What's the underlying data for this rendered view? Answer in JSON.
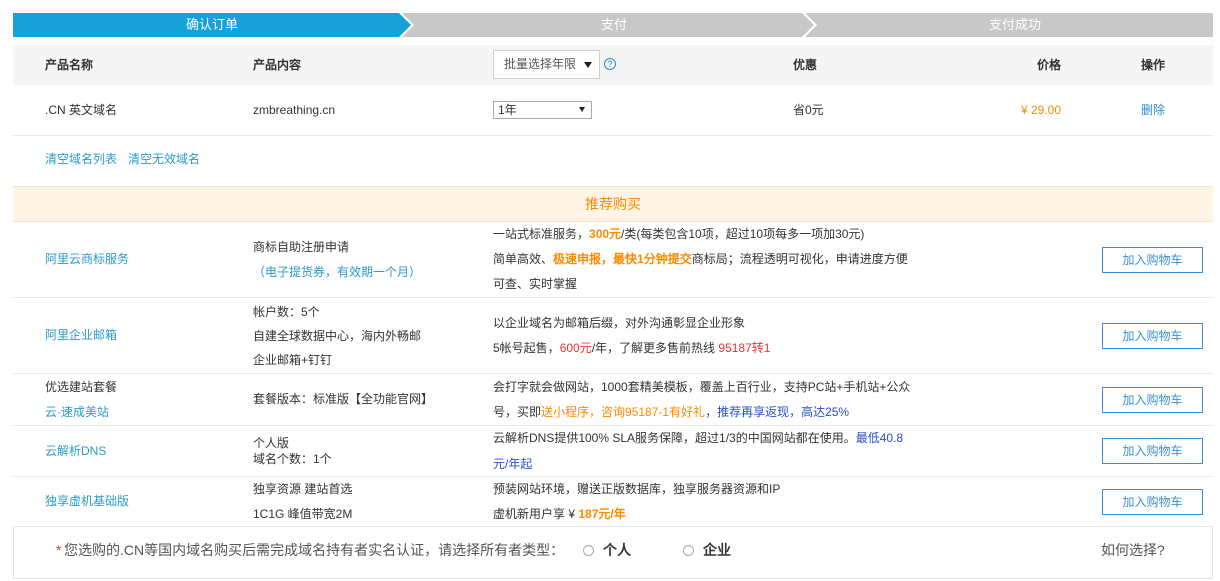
{
  "steps": [
    {
      "label": "确认订单",
      "active": true
    },
    {
      "label": "支付",
      "active": false
    },
    {
      "label": "支付成功",
      "active": false
    }
  ],
  "order": {
    "headers": {
      "name": "产品名称",
      "content": "产品内容",
      "period_select": "批量选择年限",
      "discount": "优惠",
      "price": "价格",
      "action": "操作"
    },
    "help_icon": "question-circle-icon",
    "help_glyph": "?",
    "select_icon": "caret-down-icon",
    "rows": [
      {
        "name": ".CN 英文域名",
        "content": "zmbreathing.cn",
        "period": "1年",
        "discount": "省0元",
        "price": "¥ 29.00",
        "action": "删除"
      }
    ]
  },
  "links": {
    "clear_list": "清空域名列表",
    "clear_invalid": "清空无效域名"
  },
  "recommend": {
    "title": "推荐购买",
    "rows": [
      {
        "name_lines": [
          {
            "text": "阿里云商标服务",
            "link": true
          }
        ],
        "content_lines": [
          {
            "text": "商标自助注册申请"
          },
          {
            "text": "（电子提货券，有效期一个月）",
            "color": "#2d9ac8"
          }
        ],
        "desc_lines": [
          [
            {
              "text": "一站式标准服务，"
            },
            {
              "text": "300元",
              "color": "#ff8a00",
              "bold": true
            },
            {
              "text": "/类(每类包含10项，超过10项每多一项加30元)"
            }
          ],
          [
            {
              "text": "简单高效、"
            },
            {
              "text": "极速申报，最快1分钟提交",
              "color": "#ff8a00",
              "bold": true
            },
            {
              "text": "商标局；流程透明可视化，申请进度方便"
            }
          ],
          [
            {
              "text": "可查、实时掌握"
            }
          ]
        ],
        "button": "加入购物车"
      },
      {
        "name_lines": [
          {
            "text": "阿里企业邮箱",
            "link": true
          }
        ],
        "content_lines": [
          {
            "text": "帐户数：5个"
          },
          {
            "text": "自建全球数据中心，海内外畅邮"
          },
          {
            "text": "企业邮箱+钉钉"
          }
        ],
        "desc_lines": [
          [
            {
              "text": "以企业域名为邮箱后缀，对外沟通彰显企业形象"
            }
          ],
          [
            {
              "text": "5帐号起售，"
            },
            {
              "text": "600元",
              "color": "#e8382f"
            },
            {
              "text": "/年，了解更多售前热线 "
            },
            {
              "text": "95187转1",
              "color": "#e8382f"
            }
          ]
        ],
        "button": "加入购物车"
      },
      {
        "name_lines": [
          {
            "text": "优选建站套餐",
            "link": false
          },
          {
            "text": "云·速成美站",
            "link": true
          }
        ],
        "content_lines": [
          {
            "text": "套餐版本：标准版【全功能官网】"
          }
        ],
        "desc_lines": [
          [
            {
              "text": "会打字就会做网站，1000套精美模板，覆盖上百行业，支持PC站+手机站+公众"
            }
          ],
          [
            {
              "text": "号，买即"
            },
            {
              "text": "送小程序，咨询95187-1有好礼",
              "color": "#ff8a00"
            },
            {
              "text": "，推荐再享返现，高达25%",
              "color": "#2650c8"
            }
          ]
        ],
        "button": "加入购物车"
      },
      {
        "name_lines": [
          {
            "text": "云解析DNS",
            "link": true
          }
        ],
        "content_lines": [
          {
            "text": "个人版"
          },
          {
            "text": "域名个数：1个"
          }
        ],
        "desc_lines": [
          [
            {
              "text": "云解析DNS提供100% SLA服务保障，超过1/3的中国网站都在使用。"
            },
            {
              "text": "最低40.8",
              "color": "#2650c8"
            }
          ],
          [
            {
              "text": "元/年起",
              "color": "#2650c8"
            }
          ]
        ],
        "button": "加入购物车"
      },
      {
        "name_lines": [
          {
            "text": "独享虚机基础版",
            "link": true
          }
        ],
        "content_lines": [
          {
            "text": "独享资源 建站首选"
          },
          {
            "text": "1C1G 峰值带宽2M"
          }
        ],
        "desc_lines": [
          [
            {
              "text": "预装网站环境，赠送正版数据库，独享服务器资源和IP"
            }
          ],
          [
            {
              "text": "虚机新用户享 ¥ "
            },
            {
              "text": "187元/年",
              "color": "#ff8a00",
              "bold": true
            }
          ]
        ],
        "button": "加入购物车"
      }
    ]
  },
  "verification": {
    "asterisk": "*",
    "text": "您选购的.CN等国内域名购买后需完成域名持有者实名认证，请选择所有者类型：",
    "options": [
      "个人",
      "企业"
    ],
    "help_link": "如何选择?"
  },
  "colors": {
    "primary": "#16a2d7",
    "step_inactive": "#c8c8c8",
    "link": "#2d9ac8",
    "action_link": "#2d8fd6",
    "price": "#ff8a00",
    "recommend_bg": "#fff4e6",
    "recommend_text": "#ff8a00",
    "button": "#3d8fd6",
    "required": "#e8382f"
  }
}
